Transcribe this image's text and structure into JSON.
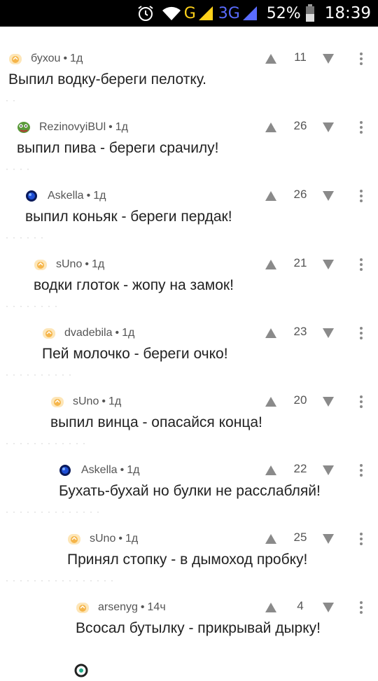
{
  "status_bar": {
    "network_g": "G",
    "network_3g": "3G",
    "battery": "52%",
    "time": "18:39"
  },
  "comments": [
    {
      "user": "бухоu",
      "sep": "•",
      "age": "1д",
      "text": "Выпил водку-береги пелотку.",
      "score": "11",
      "avatar": "orange"
    },
    {
      "user": "RezinovyiBUl",
      "sep": "•",
      "age": "1д",
      "text": "выпил пива - береги срачилу!",
      "score": "26",
      "avatar": "pepe"
    },
    {
      "user": "Askella",
      "sep": "•",
      "age": "1д",
      "text": "выпил коньяк - береги пердак!",
      "score": "26",
      "avatar": "blue"
    },
    {
      "user": "sUno",
      "sep": "•",
      "age": "1д",
      "text": "водки глоток - жопу на замок!",
      "score": "21",
      "avatar": "orange"
    },
    {
      "user": "dvadebila",
      "sep": "•",
      "age": "1д",
      "text": "Пей молочко - береги очко!",
      "score": "23",
      "avatar": "orange"
    },
    {
      "user": "sUno",
      "sep": "•",
      "age": "1д",
      "text": "выпил винца - опасайся конца!",
      "score": "20",
      "avatar": "orange"
    },
    {
      "user": "Askella",
      "sep": "•",
      "age": "1д",
      "text": "Бухать-бухай но булки не расслабляй!",
      "score": "22",
      "avatar": "blue"
    },
    {
      "user": "sUno",
      "sep": "•",
      "age": "1д",
      "text": "Принял стопку - в дымоход пробку!",
      "score": "25",
      "avatar": "orange"
    },
    {
      "user": "arsenyg",
      "sep": "•",
      "age": "14ч",
      "text": "Всосал бутылку - прикрывай дырку!",
      "score": "4",
      "avatar": "orange"
    }
  ],
  "colors": {
    "arrow": "#8a8a8a",
    "meta_text": "#555555",
    "body_text": "#222222",
    "avatar_orange": "#f5b54a",
    "avatar_blue": "#1f4fd6"
  }
}
